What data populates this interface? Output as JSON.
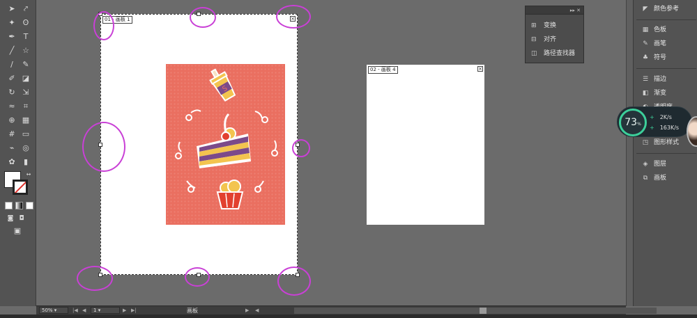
{
  "toolbar": {
    "tools": [
      "selection-tool",
      "direct-selection-tool",
      "magic-wand-tool",
      "lasso-tool",
      "pen-tool",
      "type-tool",
      "line-tool",
      "rectangle-tool",
      "paintbrush-tool",
      "pencil-tool",
      "blob-brush-tool",
      "eraser-tool",
      "rotate-tool",
      "scale-tool",
      "width-tool",
      "free-transform-tool",
      "shape-builder-tool",
      "perspective-grid-tool",
      "mesh-tool",
      "gradient-tool",
      "eyedropper-tool",
      "blend-tool",
      "symbol-sprayer-tool",
      "column-graph-tool",
      "artboard-tool",
      "slice-tool",
      "hand-tool",
      "zoom-tool"
    ]
  },
  "artboards": [
    {
      "label": "01 - 画板 1"
    },
    {
      "label": "02 - 画板 4"
    }
  ],
  "float_panel": {
    "items": [
      {
        "label": "变换",
        "icon": "transform-icon"
      },
      {
        "label": "对齐",
        "icon": "align-icon"
      },
      {
        "label": "路径查找器",
        "icon": "pathfinder-icon"
      }
    ]
  },
  "right_dock": {
    "groups": [
      [
        {
          "label": "颜色参考",
          "icon": "color-guide-icon"
        }
      ],
      [
        {
          "label": "色板",
          "icon": "swatches-icon"
        },
        {
          "label": "画笔",
          "icon": "brushes-icon"
        },
        {
          "label": "符号",
          "icon": "symbols-icon"
        }
      ],
      [
        {
          "label": "描边",
          "icon": "stroke-icon"
        },
        {
          "label": "渐变",
          "icon": "gradient-icon"
        },
        {
          "label": "透明度",
          "icon": "transparency-icon"
        }
      ],
      [
        {
          "label": "图形样式",
          "icon": "graphic-styles-icon"
        }
      ],
      [
        {
          "label": "图层",
          "icon": "layers-icon"
        },
        {
          "label": "画板",
          "icon": "artboards-icon"
        }
      ]
    ]
  },
  "network_widget": {
    "percent": "73",
    "percent_unit": "%",
    "upload": "2K/s",
    "download": "163K/s",
    "up_sign": "+",
    "down_sign": "+"
  },
  "status_bar": {
    "zoom": "50%",
    "artboard_number": "1",
    "tool_name": "画板"
  },
  "colors": {
    "poster_bg": "#ea6f60",
    "highlight_marks": "#c940d6",
    "network_accent": "#3ccf9a"
  }
}
